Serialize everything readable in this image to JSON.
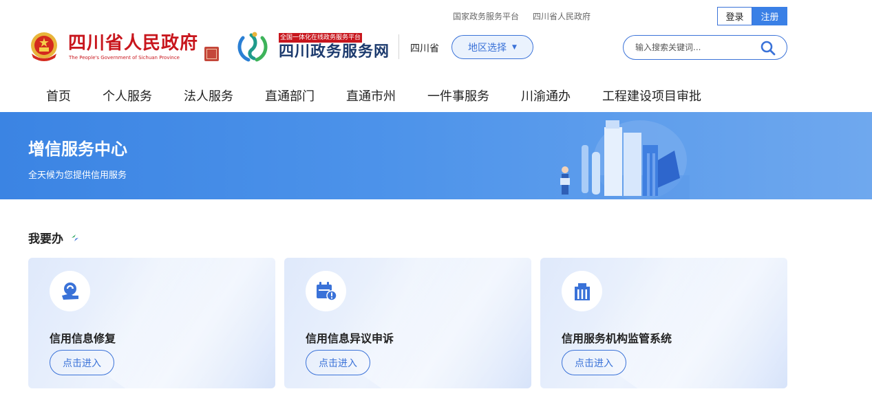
{
  "header": {
    "top_links": [
      "国家政务服务平台",
      "四川省人民政府"
    ],
    "login_label": "登录",
    "register_label": "注册",
    "gov_title": "四川省人民政府",
    "gov_subtitle": "The People's Government of Sichuan Province",
    "portal_tag": "全国一体化在线政务服务平台",
    "portal_name": "四川政务服务网",
    "province": "四川省",
    "region_label": "地区选择",
    "search_placeholder": "输入搜索关键词..."
  },
  "nav": {
    "items": [
      "首页",
      "个人服务",
      "法人服务",
      "直通部门",
      "直通市州",
      "一件事服务",
      "川渝通办",
      "工程建设项目审批"
    ]
  },
  "banner": {
    "title": "增信服务中心",
    "subtitle": "全天候为您提供信用服务"
  },
  "section": {
    "title": "我要办",
    "cards": [
      {
        "title": "信用信息修复",
        "button": "点击进入",
        "icon": "credit-repair-icon"
      },
      {
        "title": "信用信息异议申诉",
        "button": "点击进入",
        "icon": "calendar-alert-icon"
      },
      {
        "title": "信用服务机构监管系统",
        "button": "点击进入",
        "icon": "building-icon"
      }
    ]
  },
  "colors": {
    "primary": "#3a72d8",
    "gov_red": "#c8161d",
    "banner": "#4a8ee8"
  }
}
